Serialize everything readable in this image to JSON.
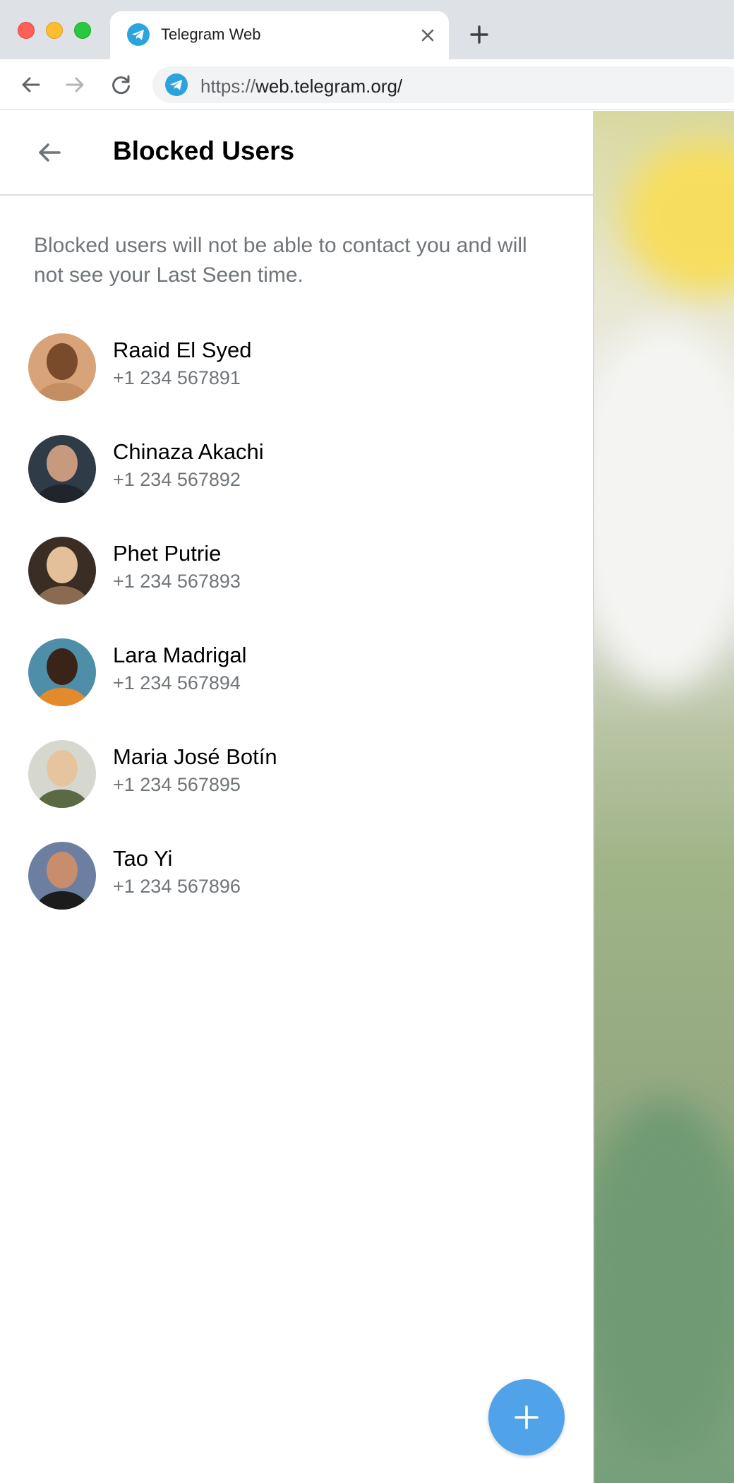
{
  "browser": {
    "tab_title": "Telegram Web",
    "url_scheme": "https://",
    "url_rest": "web.telegram.org/",
    "accent": "#2aa3df"
  },
  "panel": {
    "title": "Blocked Users",
    "notice": "Blocked users will not be able to contact you and will not see your Last Seen time."
  },
  "users": [
    {
      "name": "Raaid El Syed",
      "phone": "+1 234 567891",
      "avatar_colors": [
        "#d9a37a",
        "#7a4a2c",
        "#c58d62"
      ]
    },
    {
      "name": "Chinaza Akachi",
      "phone": "+1 234 567892",
      "avatar_colors": [
        "#2f3b47",
        "#c79a7f",
        "#1f252b"
      ]
    },
    {
      "name": "Phet Putrie",
      "phone": "+1 234 567893",
      "avatar_colors": [
        "#3a2d24",
        "#e3c09a",
        "#8b6b4f"
      ]
    },
    {
      "name": "Lara Madrigal",
      "phone": "+1 234 567894",
      "avatar_colors": [
        "#4f8ea8",
        "#3a2418",
        "#e38a2c"
      ]
    },
    {
      "name": "Maria José Botín",
      "phone": "+1 234 567895",
      "avatar_colors": [
        "#d6d7cf",
        "#e6c59e",
        "#5b6a45"
      ]
    },
    {
      "name": "Tao Yi",
      "phone": "+1 234 567896",
      "avatar_colors": [
        "#6d7fa0",
        "#c78d6d",
        "#1c1c1c"
      ]
    }
  ],
  "colors": {
    "fab": "#50a2e9",
    "secondary_text": "#707579"
  }
}
